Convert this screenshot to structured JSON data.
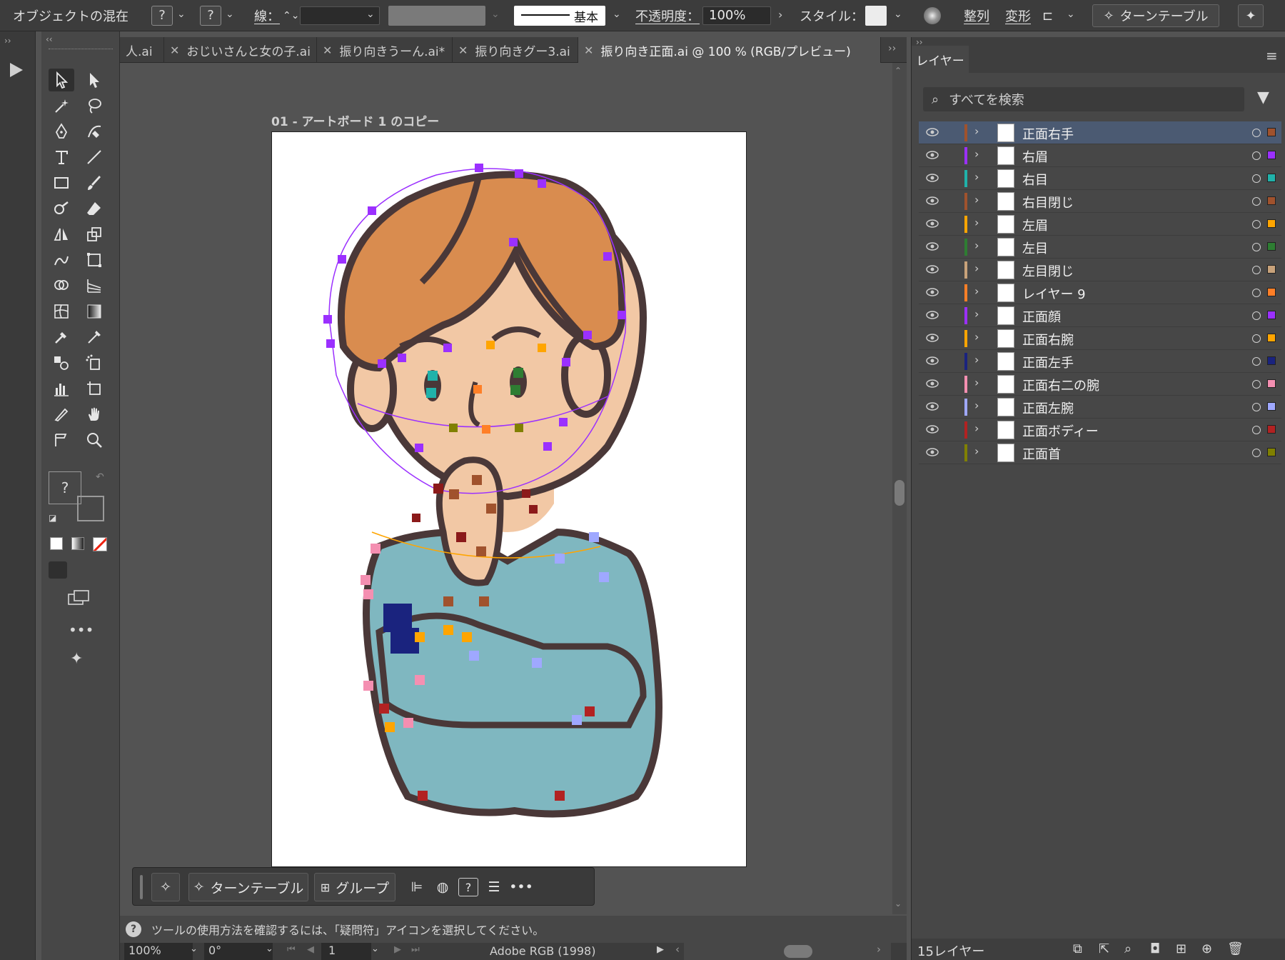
{
  "control_bar": {
    "object_type": "オブジェクトの混在",
    "fill_unknown": "?",
    "stroke_unknown": "?",
    "stroke_label": "線：",
    "brush_preset": "基本",
    "opacity_label": "不透明度：",
    "opacity_value": "100%",
    "style_label": "スタイル：",
    "align_label": "整列",
    "transform_label": "変形",
    "turntable_label": "ターンテーブル"
  },
  "tabs": [
    {
      "label": "人.ai",
      "closable": false
    },
    {
      "label": "おじいさんと女の子.ai",
      "closable": true
    },
    {
      "label": "振り向きうーん.ai*",
      "closable": true
    },
    {
      "label": "振り向きグー3.ai",
      "closable": true
    },
    {
      "label": "振り向き正面.ai @ 100 % (RGB/プレビュー)",
      "closable": true,
      "active": true
    }
  ],
  "canvas": {
    "artboard_label": "01 - アートボード 1 のコピー"
  },
  "toolbar": {
    "fill_stroke_unknown": "?",
    "more": "•••"
  },
  "context_bar": {
    "turntable_label": "ターンテーブル",
    "group_label": "グループ",
    "help": "?",
    "more": "•••"
  },
  "hint": {
    "icon": "?",
    "text": "ツールの使用方法を確認するには、「疑問符」アイコンを選択してください。"
  },
  "status": {
    "zoom": "100%",
    "rotation": "0°",
    "artboard_index": "1",
    "color_profile": "Adobe RGB (1998)"
  },
  "layers_panel": {
    "title": "レイヤー",
    "search_placeholder": "すべてを検索",
    "count_label": "15レイヤー",
    "layers": [
      {
        "name": "正面右手",
        "color": "#a0522d",
        "selected": true
      },
      {
        "name": "右眉",
        "color": "#9b30ff"
      },
      {
        "name": "右目",
        "color": "#20b2aa"
      },
      {
        "name": "右目閉じ",
        "color": "#a0522d"
      },
      {
        "name": "左眉",
        "color": "#ffa500"
      },
      {
        "name": "左目",
        "color": "#2e7d32"
      },
      {
        "name": "左目閉じ",
        "color": "#c8a27a"
      },
      {
        "name": "レイヤー 9",
        "color": "#ff7f27"
      },
      {
        "name": "正面顔",
        "color": "#9b30ff"
      },
      {
        "name": "正面右腕",
        "color": "#ffa500"
      },
      {
        "name": "正面左手",
        "color": "#1a237e"
      },
      {
        "name": "正面右二の腕",
        "color": "#f48fb1"
      },
      {
        "name": "正面左腕",
        "color": "#9fa8ff"
      },
      {
        "name": "正面ボディー",
        "color": "#b22222"
      },
      {
        "name": "正面首",
        "color": "#808000"
      }
    ]
  },
  "colors": {
    "hair": "#d98c4f",
    "skin": "#f2c8a5",
    "shirt": "#7fb7c0",
    "outline": "#4a3838",
    "selection_purple": "#9b30ff"
  }
}
